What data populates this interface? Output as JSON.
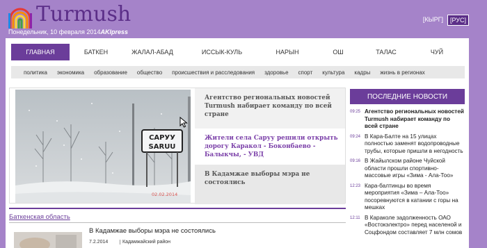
{
  "header": {
    "logo_text": "Turmush",
    "date": "Понедельник, 10 февраля 2014",
    "akipress": "AKIpress",
    "lang": [
      "[КЫРГ]",
      "[РУС]"
    ]
  },
  "main_nav": [
    "ГЛАВНАЯ",
    "БАТКЕН",
    "ЖАЛАЛ-АБАД",
    "ИССЫК-КУЛЬ",
    "НАРЫН",
    "ОШ",
    "ТАЛАС",
    "ЧУЙ"
  ],
  "sub_nav": [
    "политика",
    "экономика",
    "образование",
    "общество",
    "происшествия и расследования",
    "здоровье",
    "спорт",
    "культура",
    "кадры",
    "жизнь в регионах"
  ],
  "slider": {
    "sign_top": "САРУУ",
    "sign_bottom": "SARUU",
    "photo_date": "02.02.2014",
    "headlines": [
      "Агентство региональных новостей Turmush набирает команду по всей стране",
      "Жители села Саруу решили открыть дорогу Каракол - Боконбаево - Балыкчы, - УВД",
      "В Кадамжае выборы мэра не состоялись"
    ]
  },
  "region": {
    "title": "Баткенская область",
    "article_title": "В Кадамжае выборы мэра не состоялись",
    "article_date": "7.2.2014",
    "article_region": "Кадамжайский район"
  },
  "latest": {
    "title": "ПОСЛЕДНИЕ НОВОСТИ",
    "items": [
      {
        "time": "09:25",
        "text": "Агентство региональных новостей Turmush набирает команду по всей стране"
      },
      {
        "time": "09:24",
        "text": "В Кара-Балте на 15 улицах полностью заменят водопроводные трубы, которые пришли в негодность"
      },
      {
        "time": "09:16",
        "text": "В Жайылском районе Чуйской области прошли спортивно-массовые игры «Зима - Ала-Тоо»"
      },
      {
        "time": "12:23",
        "text": "Кара-балтинцы во время мероприятия «Зима – Ала-Тоо» посоревнуются в катании с горы на мешках"
      },
      {
        "time": "12:11",
        "text": "В Караколе задолженность ОАО «Востокэлектро» перед населеной и Соцфондом составляет 7 млн сомов"
      }
    ]
  }
}
